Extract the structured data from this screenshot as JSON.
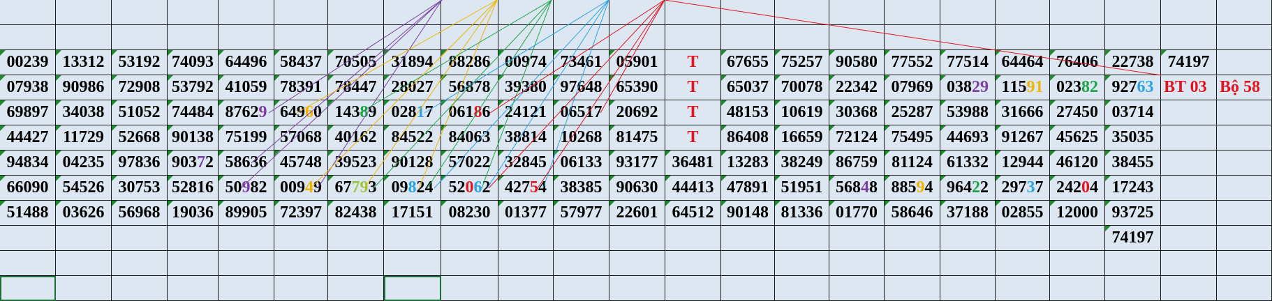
{
  "colors": {
    "purple": "#7b3fa0",
    "orange": "#f0b400",
    "green": "#21a34a",
    "blue": "#2aa3e0",
    "red": "#e0141e",
    "yellowgreen": "#9bc53d"
  },
  "rows": [
    [
      "00239",
      "13312",
      "53192",
      "74093",
      "64496",
      "58437",
      "70505",
      "31894",
      "88286",
      "00974",
      "73461",
      "05901",
      "T",
      "67655",
      "75257",
      "90580",
      "77552",
      "77514",
      "64464",
      "76406",
      "22738",
      "74197",
      ""
    ],
    [
      "07938",
      "90986",
      "72908",
      "53792",
      "41059",
      "78391",
      "78447",
      "28027",
      "56878",
      "39380",
      "97648",
      "65390",
      "T",
      "65037",
      "70078",
      "22342",
      "07969",
      "03829",
      "11591",
      "02382",
      "92763",
      "BT 03",
      ""
    ],
    [
      "69897",
      "34038",
      "51052",
      "74484",
      "87629",
      "64960",
      "14389",
      "02817",
      "06186",
      "24121",
      "06517",
      "20692",
      "T",
      "48153",
      "10619",
      "30368",
      "25287",
      "53988",
      "31666",
      "27450",
      "03714",
      "",
      ""
    ],
    [
      "44427",
      "11729",
      "52668",
      "90138",
      "75199",
      "57068",
      "40162",
      "84522",
      "84063",
      "38814",
      "10268",
      "81475",
      "T",
      "86408",
      "16659",
      "72124",
      "75495",
      "44693",
      "91267",
      "45625",
      "35035",
      "",
      ""
    ],
    [
      "94834",
      "04235",
      "97836",
      "90372",
      "58636",
      "45748",
      "39523",
      "90128",
      "57022",
      "32845",
      "06133",
      "93177",
      "36481",
      "13283",
      "38249",
      "86759",
      "81124",
      "61332",
      "12944",
      "46120",
      "38455",
      "",
      ""
    ],
    [
      "66090",
      "54526",
      "30753",
      "52816",
      "50982",
      "00949",
      "67793",
      "09824",
      "52062",
      "42754",
      "38385",
      "90630",
      "44413",
      "47891",
      "51951",
      "56848",
      "88594",
      "96422",
      "29737",
      "24204",
      "17243",
      "",
      ""
    ],
    [
      "51488",
      "03626",
      "56968",
      "19036",
      "89905",
      "72397",
      "82438",
      "17151",
      "08230",
      "01377",
      "57977",
      "22601",
      "64512",
      "90148",
      "81336",
      "01770",
      "58646",
      "37188",
      "02855",
      "12000",
      "93725",
      "",
      ""
    ],
    [
      "",
      "",
      "",
      "",
      "",
      "",
      "",
      "",
      "",
      "",
      "",
      "",
      "",
      "",
      "",
      "",
      "",
      "",
      "",
      "",
      "74197",
      "",
      ""
    ]
  ],
  "side_note": "Bộ 58"
}
